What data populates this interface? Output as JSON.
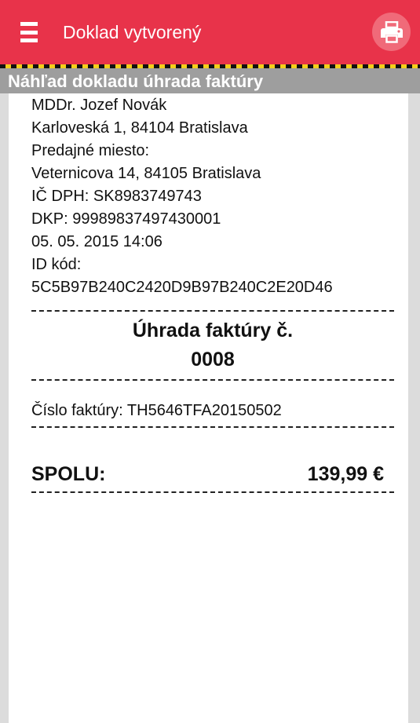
{
  "appbar": {
    "title": "Doklad vytvorený",
    "menu_icon": "hamburger-menu-icon",
    "print_icon": "printer-icon",
    "colors": {
      "bar": "#e8334a",
      "print_button": "#f06a79",
      "stripe_dark": "#111111",
      "stripe_yellow": "#f3cf1a"
    }
  },
  "section": {
    "title": "Náhľad dokladu úhrada faktúry",
    "color": "#9e9e9e"
  },
  "receipt": {
    "seller_name": "MDDr. Jozef Novák",
    "seller_address": "Karloveská 1, 84104 Bratislava",
    "store_label": "Predajné miesto:",
    "store_address": "Veternicova  14, 84105 Bratislava",
    "vat_label": "IČ DPH:",
    "vat_value": "SK8983749743",
    "dkp_label": "DKP:",
    "dkp_value": "99989837497430001",
    "datetime": "05. 05. 2015 14:06",
    "id_label": "ID kód:",
    "id_value": "5C5B97B240C2420D9B97B240C2E20D46",
    "doc_title": "Úhrada faktúry č.",
    "doc_number": "0008",
    "invoice_label": "Číslo faktúry:",
    "invoice_value": "TH5646TFA20150502",
    "total_label": "SPOLU:",
    "total_value": "139,99 €"
  }
}
